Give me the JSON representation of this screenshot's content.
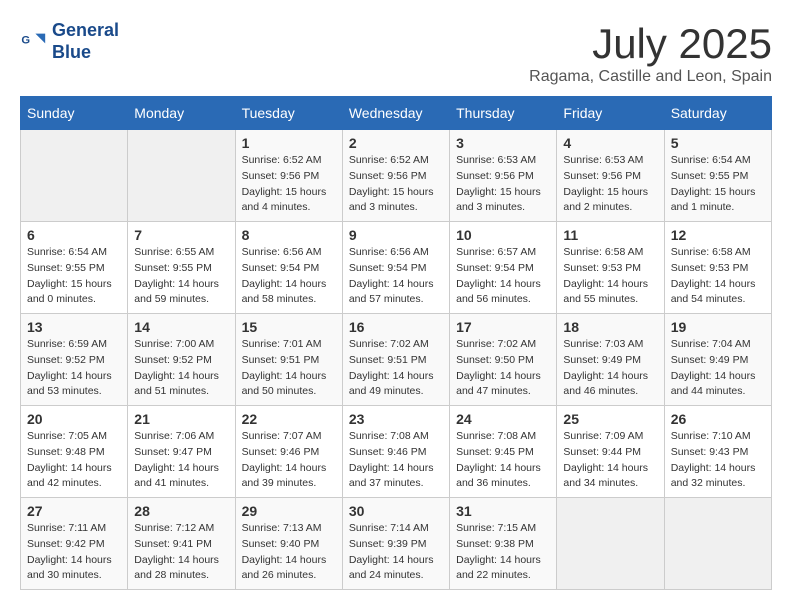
{
  "header": {
    "logo_line1": "General",
    "logo_line2": "Blue",
    "month_title": "July 2025",
    "subtitle": "Ragama, Castille and Leon, Spain"
  },
  "weekdays": [
    "Sunday",
    "Monday",
    "Tuesday",
    "Wednesday",
    "Thursday",
    "Friday",
    "Saturday"
  ],
  "weeks": [
    [
      null,
      null,
      {
        "day": 1,
        "sunrise": "6:52 AM",
        "sunset": "9:56 PM",
        "daylight": "15 hours and 4 minutes."
      },
      {
        "day": 2,
        "sunrise": "6:52 AM",
        "sunset": "9:56 PM",
        "daylight": "15 hours and 3 minutes."
      },
      {
        "day": 3,
        "sunrise": "6:53 AM",
        "sunset": "9:56 PM",
        "daylight": "15 hours and 3 minutes."
      },
      {
        "day": 4,
        "sunrise": "6:53 AM",
        "sunset": "9:56 PM",
        "daylight": "15 hours and 2 minutes."
      },
      {
        "day": 5,
        "sunrise": "6:54 AM",
        "sunset": "9:55 PM",
        "daylight": "15 hours and 1 minute."
      }
    ],
    [
      {
        "day": 6,
        "sunrise": "6:54 AM",
        "sunset": "9:55 PM",
        "daylight": "15 hours and 0 minutes."
      },
      {
        "day": 7,
        "sunrise": "6:55 AM",
        "sunset": "9:55 PM",
        "daylight": "14 hours and 59 minutes."
      },
      {
        "day": 8,
        "sunrise": "6:56 AM",
        "sunset": "9:54 PM",
        "daylight": "14 hours and 58 minutes."
      },
      {
        "day": 9,
        "sunrise": "6:56 AM",
        "sunset": "9:54 PM",
        "daylight": "14 hours and 57 minutes."
      },
      {
        "day": 10,
        "sunrise": "6:57 AM",
        "sunset": "9:54 PM",
        "daylight": "14 hours and 56 minutes."
      },
      {
        "day": 11,
        "sunrise": "6:58 AM",
        "sunset": "9:53 PM",
        "daylight": "14 hours and 55 minutes."
      },
      {
        "day": 12,
        "sunrise": "6:58 AM",
        "sunset": "9:53 PM",
        "daylight": "14 hours and 54 minutes."
      }
    ],
    [
      {
        "day": 13,
        "sunrise": "6:59 AM",
        "sunset": "9:52 PM",
        "daylight": "14 hours and 53 minutes."
      },
      {
        "day": 14,
        "sunrise": "7:00 AM",
        "sunset": "9:52 PM",
        "daylight": "14 hours and 51 minutes."
      },
      {
        "day": 15,
        "sunrise": "7:01 AM",
        "sunset": "9:51 PM",
        "daylight": "14 hours and 50 minutes."
      },
      {
        "day": 16,
        "sunrise": "7:02 AM",
        "sunset": "9:51 PM",
        "daylight": "14 hours and 49 minutes."
      },
      {
        "day": 17,
        "sunrise": "7:02 AM",
        "sunset": "9:50 PM",
        "daylight": "14 hours and 47 minutes."
      },
      {
        "day": 18,
        "sunrise": "7:03 AM",
        "sunset": "9:49 PM",
        "daylight": "14 hours and 46 minutes."
      },
      {
        "day": 19,
        "sunrise": "7:04 AM",
        "sunset": "9:49 PM",
        "daylight": "14 hours and 44 minutes."
      }
    ],
    [
      {
        "day": 20,
        "sunrise": "7:05 AM",
        "sunset": "9:48 PM",
        "daylight": "14 hours and 42 minutes."
      },
      {
        "day": 21,
        "sunrise": "7:06 AM",
        "sunset": "9:47 PM",
        "daylight": "14 hours and 41 minutes."
      },
      {
        "day": 22,
        "sunrise": "7:07 AM",
        "sunset": "9:46 PM",
        "daylight": "14 hours and 39 minutes."
      },
      {
        "day": 23,
        "sunrise": "7:08 AM",
        "sunset": "9:46 PM",
        "daylight": "14 hours and 37 minutes."
      },
      {
        "day": 24,
        "sunrise": "7:08 AM",
        "sunset": "9:45 PM",
        "daylight": "14 hours and 36 minutes."
      },
      {
        "day": 25,
        "sunrise": "7:09 AM",
        "sunset": "9:44 PM",
        "daylight": "14 hours and 34 minutes."
      },
      {
        "day": 26,
        "sunrise": "7:10 AM",
        "sunset": "9:43 PM",
        "daylight": "14 hours and 32 minutes."
      }
    ],
    [
      {
        "day": 27,
        "sunrise": "7:11 AM",
        "sunset": "9:42 PM",
        "daylight": "14 hours and 30 minutes."
      },
      {
        "day": 28,
        "sunrise": "7:12 AM",
        "sunset": "9:41 PM",
        "daylight": "14 hours and 28 minutes."
      },
      {
        "day": 29,
        "sunrise": "7:13 AM",
        "sunset": "9:40 PM",
        "daylight": "14 hours and 26 minutes."
      },
      {
        "day": 30,
        "sunrise": "7:14 AM",
        "sunset": "9:39 PM",
        "daylight": "14 hours and 24 minutes."
      },
      {
        "day": 31,
        "sunrise": "7:15 AM",
        "sunset": "9:38 PM",
        "daylight": "14 hours and 22 minutes."
      },
      null,
      null
    ]
  ],
  "labels": {
    "sunrise": "Sunrise:",
    "sunset": "Sunset:",
    "daylight": "Daylight:"
  }
}
